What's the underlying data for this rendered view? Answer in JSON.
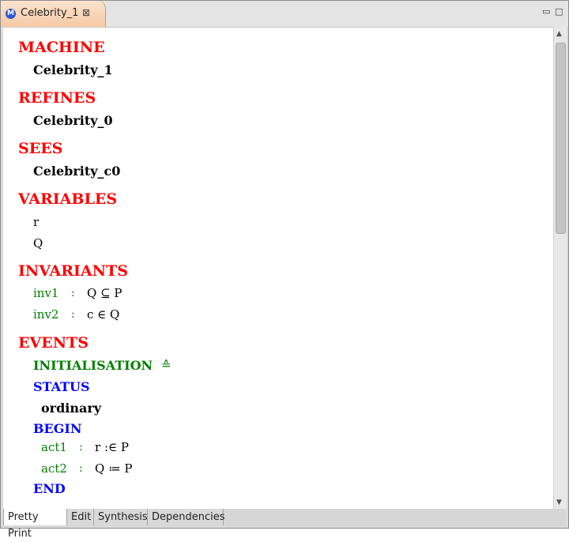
{
  "tab": {
    "title": "Celebrity_1",
    "icon": "M",
    "close": "⊠"
  },
  "window_controls": {
    "minimize": "▭",
    "maximize": "□"
  },
  "machine": {
    "kw": "MACHINE",
    "name": "Celebrity_1",
    "refines_kw": "REFINES",
    "refines": "Celebrity_0",
    "sees_kw": "SEES",
    "sees": "Celebrity_c0",
    "variables_kw": "VARIABLES",
    "variables": [
      "r",
      "Q"
    ],
    "invariants_kw": "INVARIANTS",
    "invariants": [
      {
        "label": "inv1",
        "sep": ":",
        "pred": "Q ⊆ P"
      },
      {
        "label": "inv2",
        "sep": ":",
        "pred": "c ∈ Q"
      }
    ],
    "events_kw": "EVENTS",
    "event": {
      "name": "INITIALISATION",
      "def": "≙",
      "status_kw": "STATUS",
      "status": "ordinary",
      "begin_kw": "BEGIN",
      "actions": [
        {
          "label": "act1",
          "sep": ":",
          "expr": "r :∈ P"
        },
        {
          "label": "act2",
          "sep": ":",
          "expr": "Q ≔ P"
        }
      ],
      "end_kw": "END"
    }
  },
  "bottom_tabs": [
    "Pretty Print",
    "Edit",
    "Synthesis",
    "Dependencies"
  ]
}
